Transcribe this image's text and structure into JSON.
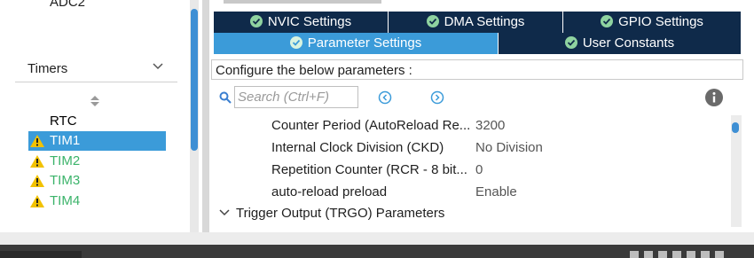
{
  "left_panel": {
    "partial_item": "ADC2",
    "category": {
      "title": "Timers"
    },
    "peripherals": [
      {
        "label": "RTC",
        "warning": false,
        "state": "normal"
      },
      {
        "label": "TIM1",
        "warning": true,
        "state": "selected"
      },
      {
        "label": "TIM2",
        "warning": true,
        "state": "configured"
      },
      {
        "label": "TIM3",
        "warning": true,
        "state": "configured"
      },
      {
        "label": "TIM4",
        "warning": true,
        "state": "configured"
      }
    ]
  },
  "tabs": [
    {
      "label": "NVIC Settings",
      "active": false
    },
    {
      "label": "DMA Settings",
      "active": false
    },
    {
      "label": "GPIO Settings",
      "active": false
    },
    {
      "label": "Parameter Settings",
      "active": true
    },
    {
      "label": "User Constants",
      "active": false
    }
  ],
  "configure_text": "Configure the below parameters :",
  "search": {
    "placeholder": "Search (Ctrl+F)"
  },
  "parameters": [
    {
      "name": "Counter Period (AutoReload Re...",
      "value": "3200"
    },
    {
      "name": "Internal Clock Division (CKD)",
      "value": "No Division"
    },
    {
      "name": "Repetition Counter (RCR - 8 bit...",
      "value": "0"
    },
    {
      "name": "auto-reload preload",
      "value": "Enable"
    }
  ],
  "group": {
    "label": "Trigger Output (TRGO) Parameters"
  },
  "colors": {
    "selected_bg": "#3b9bd9",
    "tab_dark": "#0f2a4a",
    "configured_green": "#3bb36a",
    "warning_yellow": "#f2c200"
  },
  "icons": {
    "tab_icon": "check-circle-icon",
    "warning": "warning-triangle-icon",
    "search": "search-icon",
    "prev": "chevron-left-circle-icon",
    "next": "chevron-right-circle-icon",
    "info": "info-icon"
  }
}
